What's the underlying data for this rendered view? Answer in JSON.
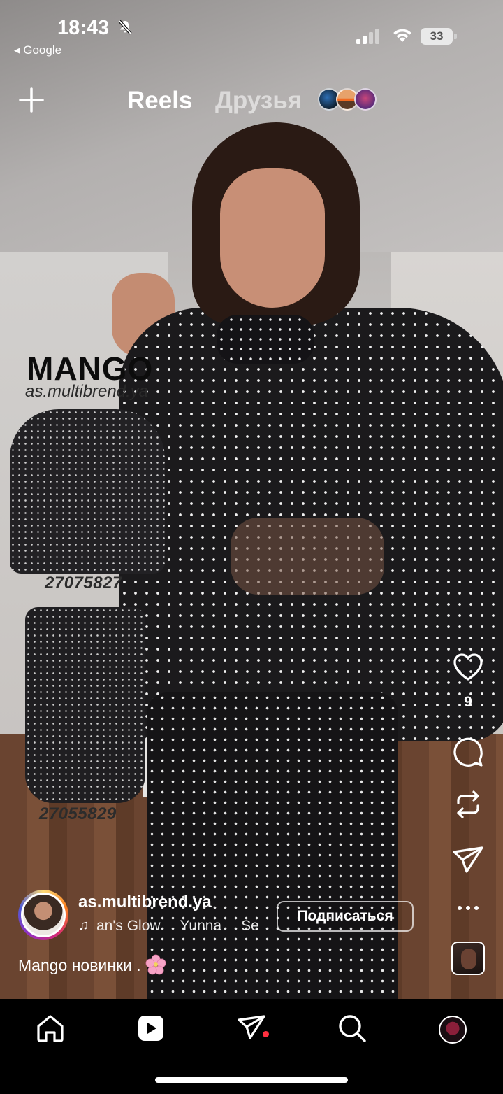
{
  "status_bar": {
    "time": "18:43",
    "back_app": "◂ Google",
    "battery": "33"
  },
  "header": {
    "tabs": [
      {
        "label": "Reels",
        "active": true
      },
      {
        "label": "Друзья",
        "active": false
      }
    ]
  },
  "video": {
    "brand": "MANGO",
    "brand_sub": "as.multibrend.ya",
    "product_codes": [
      "27075827",
      "27055829"
    ]
  },
  "actions": {
    "like_count": "9"
  },
  "post": {
    "username": "as.multibrend.ya",
    "music_segments": [
      "an's Glow",
      "Yunna",
      "Se"
    ],
    "subscribe_label": "Подписаться",
    "caption": "Mango новинки ."
  },
  "bottom_nav": [
    "home-icon",
    "reels-icon",
    "direct-icon",
    "search-icon",
    "profile-avatar"
  ],
  "colors": {
    "notification_dot": "#ff3040",
    "background": "#000000"
  }
}
